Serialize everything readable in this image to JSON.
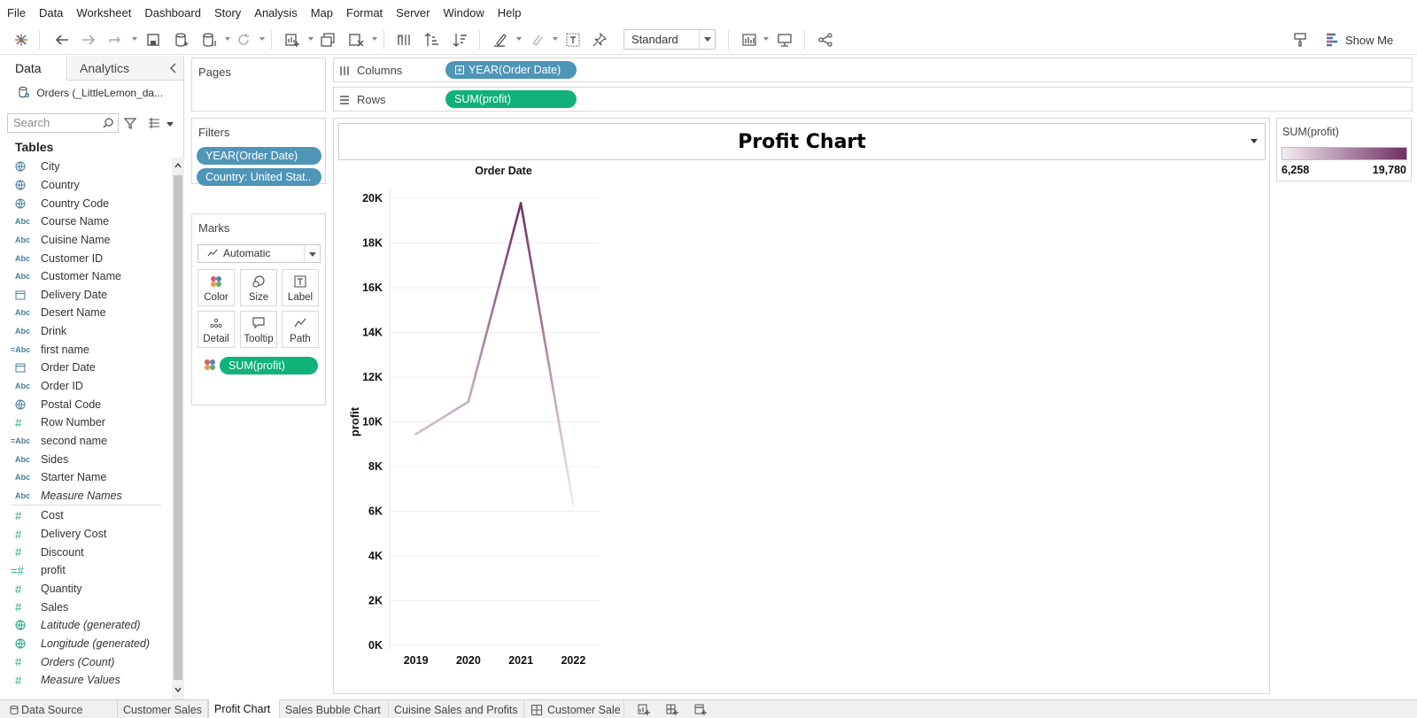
{
  "menu": [
    "File",
    "Data",
    "Worksheet",
    "Dashboard",
    "Story",
    "Analysis",
    "Map",
    "Format",
    "Server",
    "Window",
    "Help"
  ],
  "toolbar": {
    "fit_select": "Standard",
    "show_me": "Show Me",
    "icons": [
      "tableau-logo-icon",
      "undo-icon",
      "redo-icon",
      "replay-icon",
      "save-icon",
      "new-datasource-icon",
      "pause-update-icon",
      "refresh-icon",
      "new-worksheet-icon",
      "duplicate-icon",
      "clear-icon",
      "swap-icon",
      "sort-ascending-icon",
      "sort-descending-icon",
      "highlight-icon",
      "group-icon",
      "labels-icon",
      "pin-icon",
      "chart-type-icon",
      "presentation-icon",
      "share-icon",
      "format-painter-icon",
      "show-me-icon"
    ]
  },
  "data_pane": {
    "tab_data": "Data",
    "tab_analytics": "Analytics",
    "datasource": "Orders (_LittleLemon_da...",
    "search_placeholder": "Search",
    "tables_title": "Tables",
    "dimensions": [
      {
        "icon": "globe",
        "label": "City"
      },
      {
        "icon": "globe",
        "label": "Country"
      },
      {
        "icon": "globe",
        "label": "Country Code"
      },
      {
        "icon": "Abc",
        "label": "Course Name"
      },
      {
        "icon": "Abc",
        "label": "Cuisine Name"
      },
      {
        "icon": "Abc",
        "label": "Customer ID"
      },
      {
        "icon": "Abc",
        "label": "Customer Name"
      },
      {
        "icon": "calendar",
        "label": "Delivery Date"
      },
      {
        "icon": "Abc",
        "label": "Desert Name"
      },
      {
        "icon": "Abc",
        "label": "Drink"
      },
      {
        "icon": "=Abc",
        "label": "first name"
      },
      {
        "icon": "calendar",
        "label": "Order Date"
      },
      {
        "icon": "Abc",
        "label": "Order ID"
      },
      {
        "icon": "globe",
        "label": "Postal Code"
      },
      {
        "icon": "#",
        "label": "Row Number"
      },
      {
        "icon": "=Abc",
        "label": "second name"
      },
      {
        "icon": "Abc",
        "label": "Sides"
      },
      {
        "icon": "Abc",
        "label": "Starter Name"
      },
      {
        "icon": "Abc",
        "label": "Measure Names",
        "italic": true
      }
    ],
    "measures": [
      {
        "icon": "#",
        "label": "Cost"
      },
      {
        "icon": "#",
        "label": "Delivery Cost"
      },
      {
        "icon": "#",
        "label": "Discount"
      },
      {
        "icon": "=#",
        "label": "profit"
      },
      {
        "icon": "#",
        "label": "Quantity"
      },
      {
        "icon": "#",
        "label": "Sales"
      },
      {
        "icon": "globe",
        "label": "Latitude (generated)",
        "italic": true
      },
      {
        "icon": "globe",
        "label": "Longitude (generated)",
        "italic": true
      },
      {
        "icon": "#",
        "label": "Orders (Count)",
        "italic": true
      },
      {
        "icon": "#",
        "label": "Measure Values",
        "italic": true
      }
    ]
  },
  "pages": {
    "title": "Pages"
  },
  "filters": {
    "title": "Filters",
    "pills": [
      "YEAR(Order Date)",
      "Country: United Stat.."
    ]
  },
  "marks": {
    "title": "Marks",
    "type": "Automatic",
    "buttons": [
      "Color",
      "Size",
      "Label",
      "Detail",
      "Tooltip",
      "Path"
    ],
    "pill": "SUM(profit)"
  },
  "columns": {
    "label": "Columns",
    "pill": "YEAR(Order Date)"
  },
  "rows": {
    "label": "Rows",
    "pill": "SUM(profit)"
  },
  "chart_data": {
    "type": "line",
    "title": "Profit Chart",
    "column_header": "Order Date",
    "ylabel": "profit",
    "x": [
      "2019",
      "2020",
      "2021",
      "2022"
    ],
    "values": [
      9450,
      10900,
      19780,
      6258
    ],
    "ylim": [
      0,
      20000
    ],
    "yticks": [
      0,
      2000,
      4000,
      6000,
      8000,
      10000,
      12000,
      14000,
      16000,
      18000,
      20000
    ],
    "ytick_labels": [
      "0K",
      "2K",
      "4K",
      "6K",
      "8K",
      "10K",
      "12K",
      "14K",
      "16K",
      "18K",
      "20K"
    ],
    "color_low": "#f2ecf0",
    "color_high": "#6f2f63",
    "grid": true
  },
  "legend": {
    "title": "SUM(profit)",
    "min": "6,258",
    "max": "19,780"
  },
  "bottom_tabs": [
    "Data Source",
    "Customer Sales",
    "Profit Chart",
    "Sales Bubble Chart",
    "Cuisine Sales and Profits",
    "Customer Sale"
  ],
  "active_tab": "Profit Chart",
  "colors": {
    "pill_blue": "#4f95b8",
    "pill_green": "#10b27a",
    "accent": "#6f2f63"
  }
}
